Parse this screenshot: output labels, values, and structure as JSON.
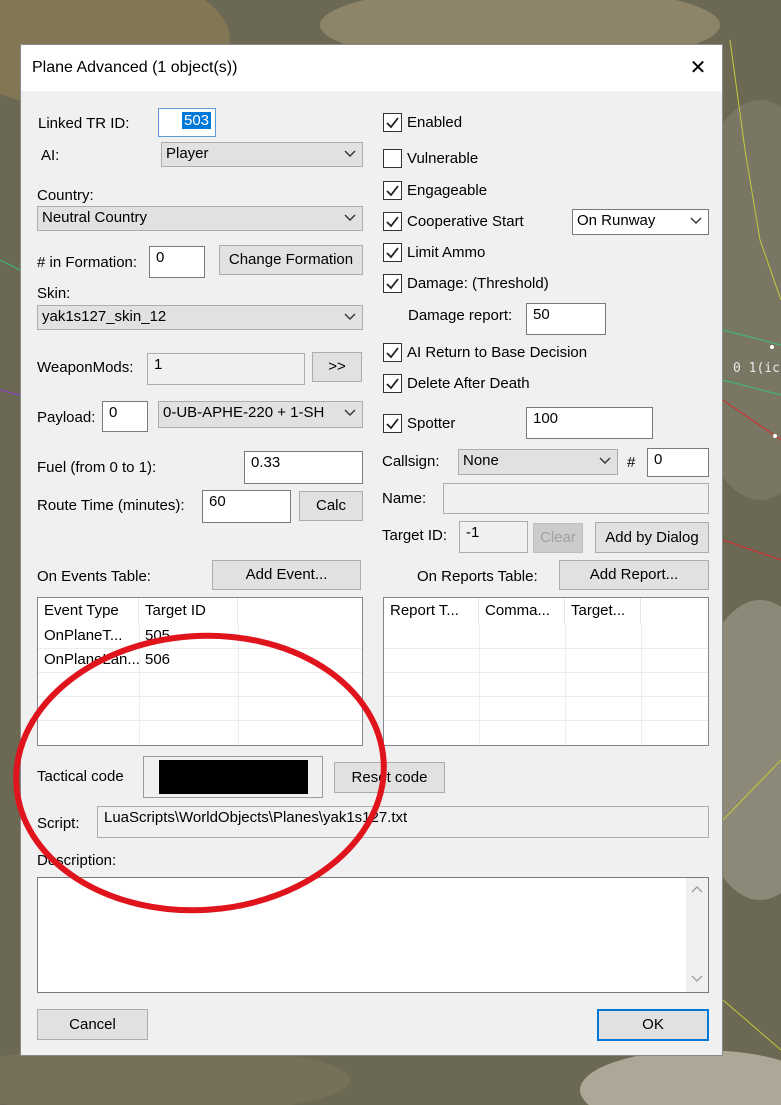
{
  "dialog": {
    "title": "Plane Advanced (1 object(s))",
    "close_glyph": "✕"
  },
  "left": {
    "linked_tr_id_label": "Linked TR ID:",
    "linked_tr_id_value": "503",
    "ai_label": "AI:",
    "ai_value": "Player",
    "country_label": "Country:",
    "country_value": "Neutral Country",
    "formation_label": "# in Formation:",
    "formation_value": "0",
    "change_formation_label": "Change Formation",
    "skin_label": "Skin:",
    "skin_value": "yak1s127_skin_12",
    "weaponmods_label": "WeaponMods:",
    "weaponmods_value": "1",
    "weaponmods_button": ">>",
    "payload_label": "Payload:",
    "payload_value": "0",
    "payload_combo": "0-UB-APHE-220 + 1-SH",
    "fuel_label": "Fuel (from 0 to 1):",
    "fuel_value": "0.33",
    "route_time_label": "Route Time (minutes):",
    "route_time_value": "60",
    "calc_label": "Calc"
  },
  "right": {
    "checkboxes": [
      {
        "label": "Enabled",
        "checked": true
      },
      {
        "label": "Vulnerable",
        "checked": false
      },
      {
        "label": "Engageable",
        "checked": true
      },
      {
        "label": "Cooperative Start",
        "checked": true
      },
      {
        "label": "Limit Ammo",
        "checked": true
      },
      {
        "label": "Damage: (Threshold)",
        "checked": true
      },
      {
        "label": "AI Return to Base Decision",
        "checked": true
      },
      {
        "label": "Delete After Death",
        "checked": true
      },
      {
        "label": "Spotter",
        "checked": true
      }
    ],
    "coop_start_value": "On Runway",
    "damage_report_label": "Damage report:",
    "damage_report_value": "50",
    "spotter_value": "100",
    "callsign_label": "Callsign:",
    "callsign_value": "None",
    "callsign_hash": "#",
    "callsign_number": "0",
    "name_label": "Name:",
    "name_value": "",
    "target_id_label": "Target ID:",
    "target_id_value": "-1",
    "clear_label": "Clear",
    "add_by_dialog_label": "Add by Dialog"
  },
  "events": {
    "label": "On Events Table:",
    "add_button": "Add Event...",
    "columns": [
      "Event Type",
      "Target ID"
    ],
    "rows": [
      [
        "OnPlaneT...",
        "505"
      ],
      [
        "OnPlaneLan...",
        "506"
      ]
    ]
  },
  "reports": {
    "label": "On Reports Table:",
    "add_button": "Add Report...",
    "columns": [
      "Report T...",
      "Comma...",
      "Target..."
    ],
    "rows": []
  },
  "bottom": {
    "tactical_code_label": "Tactical code",
    "reset_code_label": "Reset code",
    "script_label": "Script:",
    "script_value": "LuaScripts\\WorldObjects\\Planes\\yak1s127.txt",
    "description_label": "Description:",
    "description_value": "",
    "cancel_label": "Cancel",
    "ok_label": "OK"
  },
  "background": {
    "map_label": "0 1(ic"
  },
  "colors": {
    "annotation_circle": "#e0141c",
    "selection": "#0078d7",
    "tactical_swatch": "#000000"
  }
}
